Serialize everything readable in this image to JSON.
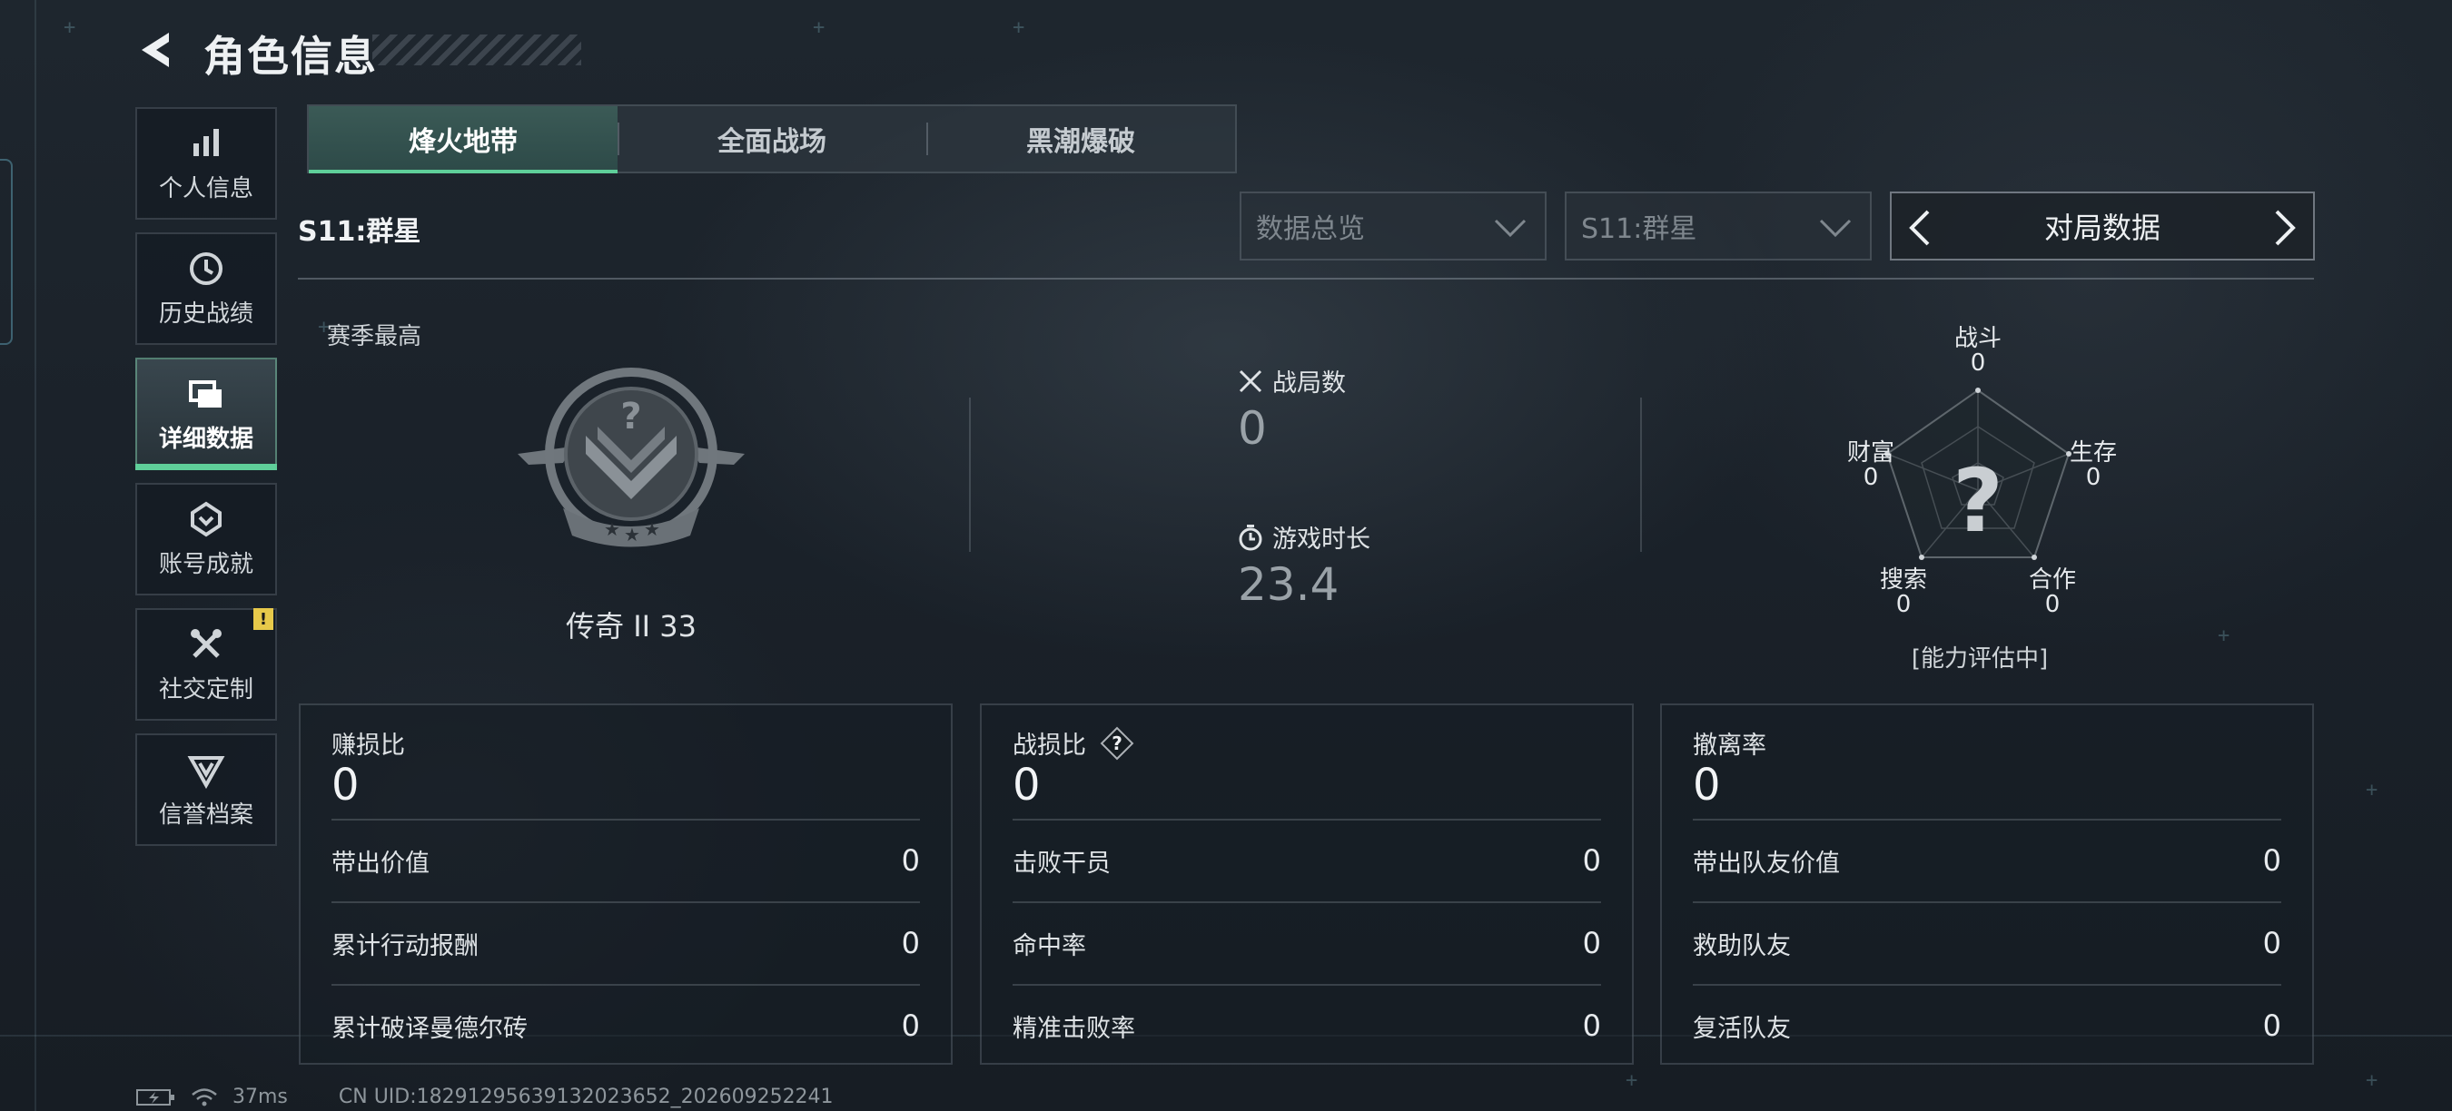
{
  "header": {
    "title": "角色信息"
  },
  "sidebar": {
    "items": [
      {
        "label": "个人信息",
        "icon": "bar-chart-icon"
      },
      {
        "label": "历史战绩",
        "icon": "history-icon"
      },
      {
        "label": "详细数据",
        "icon": "folders-icon",
        "active": true
      },
      {
        "label": "账号成就",
        "icon": "achievement-icon"
      },
      {
        "label": "社交定制",
        "icon": "tools-icon",
        "badge": "!"
      },
      {
        "label": "信誉档案",
        "icon": "credit-shield-icon"
      }
    ]
  },
  "mode_tabs": [
    {
      "label": "烽火地带",
      "active": true
    },
    {
      "label": "全面战场"
    },
    {
      "label": "黑潮爆破"
    }
  ],
  "season": {
    "title": "S11:群星",
    "filter_overview": "数据总览",
    "filter_season": "S11:群星",
    "pager_label": "对局数据"
  },
  "rank": {
    "section_label": "赛季最高",
    "rank_text": "传奇 II 33"
  },
  "stats": {
    "matches_label": "战局数",
    "matches_value": "0",
    "playtime_label": "游戏时长",
    "playtime_value": "23.4"
  },
  "radar": {
    "axes": [
      {
        "label": "战斗",
        "value": "0"
      },
      {
        "label": "生存",
        "value": "0"
      },
      {
        "label": "合作",
        "value": "0"
      },
      {
        "label": "搜索",
        "value": "0"
      },
      {
        "label": "财富",
        "value": "0"
      }
    ],
    "center_symbol": "?",
    "note": "[能力评估中]"
  },
  "cards": [
    {
      "label": "赚损比",
      "value": "0",
      "rows": [
        {
          "label": "带出价值",
          "value": "0"
        },
        {
          "label": "累计行动报酬",
          "value": "0"
        },
        {
          "label": "累计破译曼德尔砖",
          "value": "0"
        }
      ]
    },
    {
      "label": "战损比",
      "value": "0",
      "help": "?",
      "rows": [
        {
          "label": "击败干员",
          "value": "0"
        },
        {
          "label": "命中率",
          "value": "0"
        },
        {
          "label": "精准击败率",
          "value": "0"
        }
      ]
    },
    {
      "label": "撤离率",
      "value": "0",
      "rows": [
        {
          "label": "带出队友价值",
          "value": "0"
        },
        {
          "label": "救助队友",
          "value": "0"
        },
        {
          "label": "复活队友",
          "value": "0"
        }
      ]
    }
  ],
  "status_bar": {
    "ping": "37ms",
    "uid": "CN UID:18291295639132023652_202609252241"
  },
  "colors": {
    "accent": "#5fcf9a",
    "badge": "#e7c94a",
    "background": "#1b222a"
  }
}
